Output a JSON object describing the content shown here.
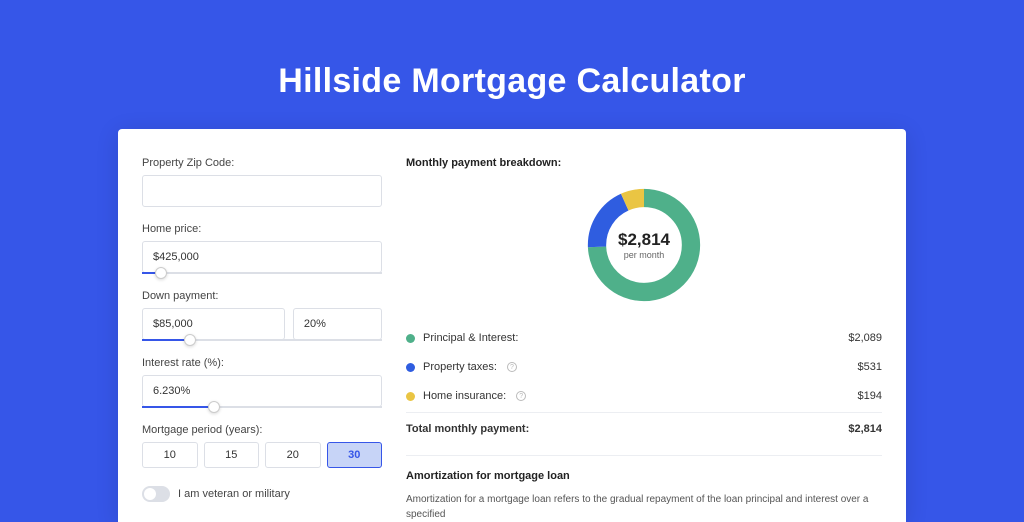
{
  "page_title": "Hillside Mortgage Calculator",
  "colors": {
    "brand": "#3656e8",
    "principal": "#4fb08a",
    "taxes": "#2f5de0",
    "insurance": "#eac543"
  },
  "form": {
    "zip": {
      "label": "Property Zip Code:",
      "value": ""
    },
    "home_price": {
      "label": "Home price:",
      "value": "$425,000",
      "slider_pct": 8
    },
    "down_payment": {
      "label": "Down payment:",
      "amount": "$85,000",
      "percent": "20%",
      "slider_pct": 20
    },
    "interest_rate": {
      "label": "Interest rate (%):",
      "value": "6.230%",
      "slider_pct": 30
    },
    "period": {
      "label": "Mortgage period (years):",
      "options": [
        "10",
        "15",
        "20",
        "30"
      ],
      "selected": "30"
    },
    "veteran": {
      "label": "I am veteran or military",
      "value": false
    }
  },
  "breakdown": {
    "title": "Monthly payment breakdown:",
    "donut": {
      "amount": "$2,814",
      "sublabel": "per month"
    },
    "rows": [
      {
        "label": "Principal & Interest:",
        "value": "$2,089",
        "dot_color": "#4fb08a",
        "info": false
      },
      {
        "label": "Property taxes:",
        "value": "$531",
        "dot_color": "#2f5de0",
        "info": true
      },
      {
        "label": "Home insurance:",
        "value": "$194",
        "dot_color": "#eac543",
        "info": true
      }
    ],
    "total": {
      "label": "Total monthly payment:",
      "value": "$2,814"
    }
  },
  "amortization": {
    "title": "Amortization for mortgage loan",
    "text": "Amortization for a mortgage loan refers to the gradual repayment of the loan principal and interest over a specified"
  },
  "chart_data": {
    "type": "pie",
    "title": "Monthly payment breakdown",
    "series": [
      {
        "name": "Principal & Interest",
        "value": 2089,
        "color": "#4fb08a"
      },
      {
        "name": "Property taxes",
        "value": 531,
        "color": "#2f5de0"
      },
      {
        "name": "Home insurance",
        "value": 194,
        "color": "#eac543"
      }
    ],
    "total": 2814,
    "center_label": "$2,814 per month"
  }
}
